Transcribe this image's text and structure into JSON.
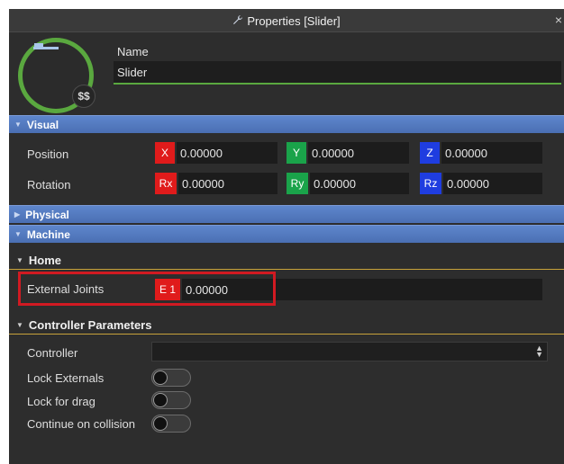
{
  "window": {
    "title": "Properties [Slider]",
    "wrench_icon": "wrench-icon",
    "close_label": "×"
  },
  "header": {
    "name_label": "Name",
    "name_value": "Slider",
    "badge_label": "$$",
    "accent": "#5aa83f"
  },
  "sections": {
    "visual": "Visual",
    "physical": "Physical",
    "machine": "Machine"
  },
  "visual": {
    "position": {
      "label": "Position",
      "x_tag": "X",
      "x": "0.00000",
      "y_tag": "Y",
      "y": "0.00000",
      "z_tag": "Z",
      "z": "0.00000"
    },
    "rotation": {
      "label": "Rotation",
      "rx_tag": "Rx",
      "rx": "0.00000",
      "ry_tag": "Ry",
      "ry": "0.00000",
      "rz_tag": "Rz",
      "rz": "0.00000"
    }
  },
  "home": {
    "title": "Home",
    "external_joints": {
      "label": "External Joints",
      "tag": "E 1",
      "value": "0.00000"
    }
  },
  "controller": {
    "title": "Controller Parameters",
    "controller_label": "Controller",
    "controller_value": "",
    "lock_externals": "Lock Externals",
    "lock_for_drag": "Lock for drag",
    "continue_on_collision": "Continue on collision"
  },
  "colors": {
    "x": "#e01b1b",
    "y": "#1aa34a",
    "z": "#1f3de0",
    "section": "#4f77bd",
    "highlight": "#d11a22"
  }
}
